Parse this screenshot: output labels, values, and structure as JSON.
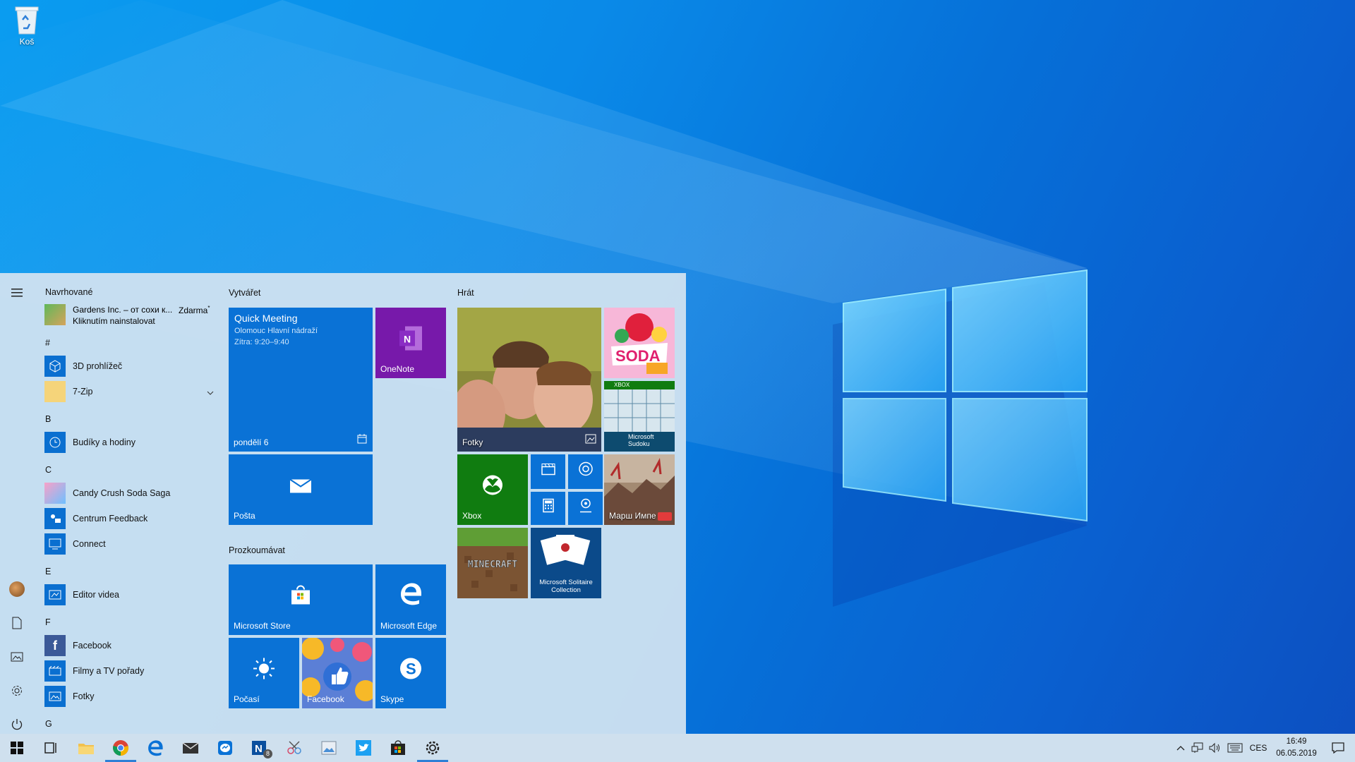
{
  "desktop": {
    "recycle_bin_label": "Koš"
  },
  "start_menu": {
    "suggested_header": "Navrhované",
    "suggested_app": {
      "name": "Gardens Inc. – от сохи к...",
      "price": "Zdarma",
      "price_mark": "*",
      "action": "Kliknutím nainstalovat"
    },
    "sections": [
      {
        "letter": "#",
        "apps": [
          "3D prohlížeč",
          "7-Zip"
        ]
      },
      {
        "letter": "B",
        "apps": [
          "Budíky a hodiny"
        ]
      },
      {
        "letter": "C",
        "apps": [
          "Candy Crush Soda Saga",
          "Centrum Feedback",
          "Connect"
        ]
      },
      {
        "letter": "E",
        "apps": [
          "Editor videa"
        ]
      },
      {
        "letter": "F",
        "apps": [
          "Facebook",
          "Filmy a TV pořady",
          "Fotky"
        ]
      },
      {
        "letter": "G",
        "apps": []
      }
    ],
    "groups": {
      "create": "Vytvářet",
      "explore": "Prozkoumávat",
      "play": "Hrát"
    },
    "tiles": {
      "calendar": {
        "title": "Quick Meeting",
        "location": "Olomouc Hlavní nádraží",
        "time": "Zítra: 9:20–9:40",
        "date": "pondělí 6"
      },
      "onenote": "OneNote",
      "mail": "Pošta",
      "store": "Microsoft Store",
      "edge": "Microsoft Edge",
      "weather": "Počasí",
      "facebook": "Facebook",
      "skype": "Skype",
      "photos": "Fotky",
      "candy": "SODA",
      "sudoku_badge": "XBOX",
      "sudoku": "Microsoft Sudoku",
      "xbox": "Xbox",
      "march": "Марш Импе",
      "minecraft": "MINECRAFT",
      "solitaire": "Microsoft Solitaire Collection"
    }
  },
  "taskbar": {
    "onenote_badge": "8",
    "language": "CES",
    "time": "16:49",
    "date": "06.05.2019"
  },
  "colors": {
    "accent": "#0a72d6",
    "xbox_green": "#107c10",
    "onenote_purple": "#7719aa",
    "start_bg": "#cde1f0",
    "taskbar_bg": "#cfe0ee"
  }
}
